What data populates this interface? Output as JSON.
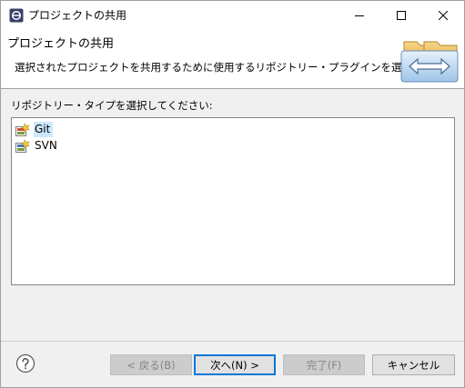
{
  "window": {
    "title": "プロジェクトの共用",
    "controls": {
      "minimize_icon": "minimize-icon",
      "maximize_icon": "maximize-icon",
      "close_icon": "close-icon"
    }
  },
  "header": {
    "title": "プロジェクトの共用",
    "description": "選択されたプロジェクトを共用するために使用するリポジトリー・プラグインを選択します。",
    "graphic_icon": "folders-exchange-icon"
  },
  "content": {
    "label": "リポジトリー・タイプを選択してください:",
    "repository_types": [
      {
        "label": "Git",
        "icon": "git-repository-icon",
        "selected": true
      },
      {
        "label": "SVN",
        "icon": "svn-repository-icon",
        "selected": false
      }
    ]
  },
  "footer": {
    "help_icon": "help-icon",
    "buttons": {
      "back": "< 戻る(B)",
      "next": "次へ(N) >",
      "finish": "完了(F)",
      "cancel": "キャンセル"
    }
  },
  "colors": {
    "selection": "#cce8ff",
    "default_button_border": "#0078d7",
    "disabled_text": "#838383"
  }
}
